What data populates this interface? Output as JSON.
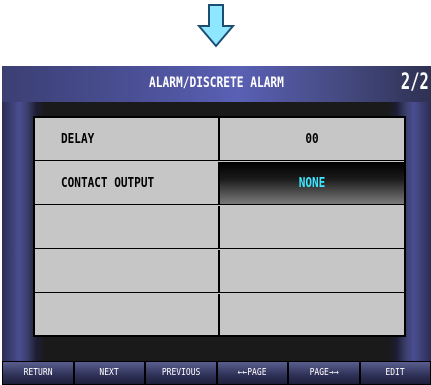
{
  "header": {
    "title": "ALARM/DISCRETE ALARM",
    "page": "2/2"
  },
  "rows": [
    {
      "label": "DELAY",
      "value": "00"
    },
    {
      "label": "CONTACT OUTPUT",
      "value": "NONE"
    },
    {
      "label": "",
      "value": ""
    },
    {
      "label": "",
      "value": ""
    },
    {
      "label": "",
      "value": ""
    }
  ],
  "buttons": {
    "return": "RETURN",
    "next": "NEXT",
    "previous": "PREVIOUS",
    "page_back": "←←PAGE",
    "page_forward": "PAGE→→",
    "edit": "EDIT"
  },
  "colors": {
    "highlight_text": "#3fe6ff",
    "arrow_fill": "#8fe6ff",
    "title_bar": "#4d529a"
  },
  "icons": {
    "arrow": "down-arrow-icon"
  }
}
